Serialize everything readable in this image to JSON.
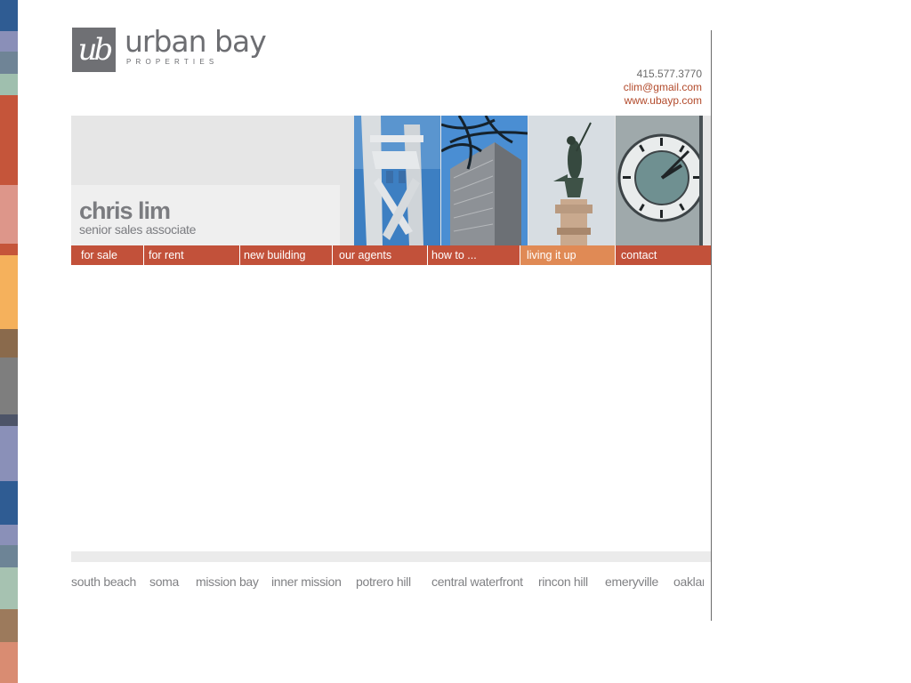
{
  "brand": {
    "logo_mark": "ub",
    "name": "urban bay",
    "sub": "PROPERTIES"
  },
  "contact": {
    "phone": "415.577.3770",
    "email": "clim@gmail.com",
    "website": "www.ubayp.com"
  },
  "agent": {
    "name": "chris lim",
    "title": "senior sales associate"
  },
  "nav": {
    "items": [
      "for sale",
      "for rent",
      "new building",
      "our agents",
      "how to ...",
      "living it up",
      "contact"
    ],
    "active": "living it up"
  },
  "areas": [
    "south beach",
    "soma",
    "mission bay",
    "inner mission",
    "potrero hill",
    "central waterfront",
    "rincon hill",
    "emeryville",
    "oaklar"
  ],
  "colors": {
    "nav": "#c2513a",
    "nav_active": "#e08a55",
    "accent_text": "#b24a2b",
    "gray_text": "#6d6e72"
  }
}
